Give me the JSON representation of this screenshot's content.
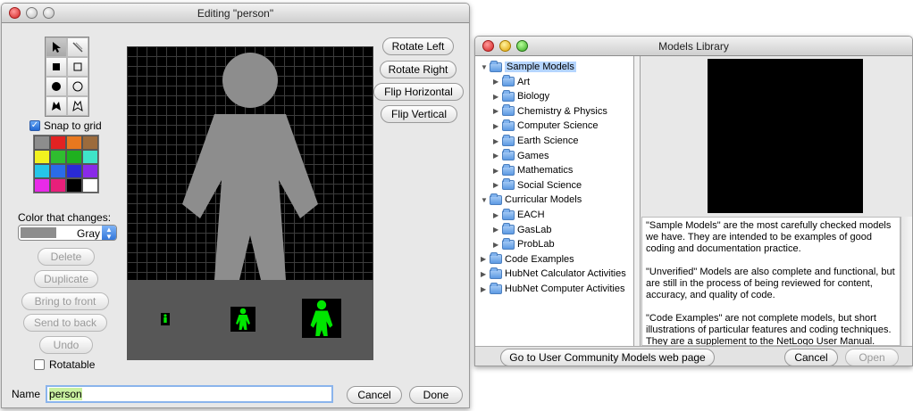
{
  "editor": {
    "title": "Editing \"person\"",
    "snap_label": "Snap to grid",
    "color_changes_label": "Color that changes:",
    "color_value": "Gray",
    "buttons": {
      "rotate_left": "Rotate Left",
      "rotate_right": "Rotate Right",
      "flip_horizontal": "Flip Horizontal",
      "flip_vertical": "Flip Vertical",
      "delete": "Delete",
      "duplicate": "Duplicate",
      "bring_to_front": "Bring to front",
      "send_to_back": "Send to back",
      "undo": "Undo",
      "cancel": "Cancel",
      "done": "Done"
    },
    "rotatable_label": "Rotatable",
    "name_label": "Name",
    "name_value": "person",
    "palette": [
      "#8d8d8d",
      "#e32222",
      "#e8781f",
      "#9c6b3c",
      "#f2f21f",
      "#2fbd2f",
      "#1fb01f",
      "#3fe3c8",
      "#25c6e8",
      "#2a6ce8",
      "#2a2ad6",
      "#8a2ae8",
      "#e82ae8",
      "#e81f7a",
      "#000000",
      "#ffffff"
    ],
    "shape_color": "#8d8d8d",
    "preview_color": "#00e600"
  },
  "library": {
    "title": "Models Library",
    "tree": [
      {
        "label": "Sample Models",
        "level": 0,
        "expanded": true,
        "selected": true
      },
      {
        "label": "Art",
        "level": 1
      },
      {
        "label": "Biology",
        "level": 1
      },
      {
        "label": "Chemistry & Physics",
        "level": 1
      },
      {
        "label": "Computer Science",
        "level": 1
      },
      {
        "label": "Earth Science",
        "level": 1
      },
      {
        "label": "Games",
        "level": 1
      },
      {
        "label": "Mathematics",
        "level": 1
      },
      {
        "label": "Social Science",
        "level": 1
      },
      {
        "label": "Curricular Models",
        "level": 0,
        "expanded": true
      },
      {
        "label": "EACH",
        "level": 1
      },
      {
        "label": "GasLab",
        "level": 1
      },
      {
        "label": "ProbLab",
        "level": 1
      },
      {
        "label": "Code Examples",
        "level": 0
      },
      {
        "label": "HubNet Calculator Activities",
        "level": 0
      },
      {
        "label": "HubNet Computer Activities",
        "level": 0
      }
    ],
    "description": [
      "\"Sample Models\" are the most carefully checked models we have. They are intended to be examples of good coding and documentation practice.",
      "\"Unverified\" Models are also complete and functional, but are still in the process of being reviewed for content, accuracy, and quality of code.",
      "\"Code Examples\" are not complete models, but short illustrations of particular features and coding techniques. They are a supplement to the NetLogo User Manual."
    ],
    "buttons": {
      "community": "Go to User Community Models web page",
      "cancel": "Cancel",
      "open": "Open"
    }
  }
}
